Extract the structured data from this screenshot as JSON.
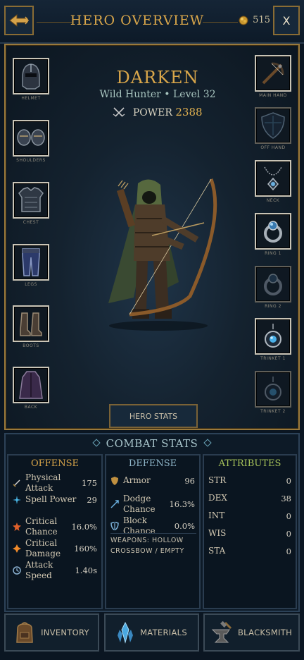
{
  "header": {
    "title": "HERO OVERVIEW",
    "gold": "515",
    "close_label": "X"
  },
  "hero": {
    "name": "DARKEN",
    "subtitle": "Wild Hunter • Level 32",
    "power_label": "POWER",
    "power_value": "2388",
    "stats_button": "HERO STATS"
  },
  "equipment": {
    "left": [
      {
        "label": "HELMET",
        "icon": "helmet-icon"
      },
      {
        "label": "SHOULDERS",
        "icon": "shoulders-icon"
      },
      {
        "label": "CHEST",
        "icon": "chest-armor-icon"
      },
      {
        "label": "LEGS",
        "icon": "leg-armor-icon"
      },
      {
        "label": "BOOTS",
        "icon": "boots-icon"
      },
      {
        "label": "BACK",
        "icon": "cloak-icon"
      }
    ],
    "right": [
      {
        "label": "MAIN HAND",
        "icon": "crossbow-icon"
      },
      {
        "label": "OFF HAND",
        "icon": "shield-icon"
      },
      {
        "label": "NECK",
        "icon": "necklace-icon"
      },
      {
        "label": "RING 1",
        "icon": "ring-icon"
      },
      {
        "label": "RING 2",
        "icon": "ring-icon"
      },
      {
        "label": "TRINKET 1",
        "icon": "trinket-icon"
      },
      {
        "label": "TRINKET 2",
        "icon": "trinket-icon"
      }
    ]
  },
  "combat": {
    "title": "COMBAT STATS",
    "offense": {
      "title": "OFFENSE",
      "rows": [
        {
          "label": "Physical Attack",
          "value": "175",
          "icon": "sword-icon"
        },
        {
          "label": "Spell Power",
          "value": "29",
          "icon": "spark-icon"
        },
        {
          "label": "Critical Chance",
          "value": "16.0%",
          "icon": "crit-chance-icon"
        },
        {
          "label": "Critical Damage",
          "value": "160%",
          "icon": "crit-damage-icon"
        },
        {
          "label": "Attack Speed",
          "value": "1.40s",
          "icon": "attack-speed-icon"
        }
      ]
    },
    "defense": {
      "title": "DEFENSE",
      "rows": [
        {
          "label": "Armor",
          "value": "96",
          "icon": "armor-icon"
        },
        {
          "label": "Dodge Chance",
          "value": "16.3%",
          "icon": "dodge-icon"
        },
        {
          "label": "Block Chance",
          "value": "0.0%",
          "icon": "block-icon"
        }
      ],
      "weapons_line1": "WEAPONS: HOLLOW",
      "weapons_line2": "CROSSBOW / EMPTY"
    },
    "attributes": {
      "title": "ATTRIBUTES",
      "rows": [
        {
          "label": "STR",
          "value": "0"
        },
        {
          "label": "DEX",
          "value": "38"
        },
        {
          "label": "INT",
          "value": "0"
        },
        {
          "label": "WIS",
          "value": "0"
        },
        {
          "label": "STA",
          "value": "0"
        }
      ]
    }
  },
  "nav": {
    "inventory": "INVENTORY",
    "materials": "MATERIALS",
    "blacksmith": "BLACKSMITH"
  },
  "colors": {
    "gold_accent": "#d9a64a",
    "offense_title": "#d9a64a",
    "defense_title": "#8fb6c9",
    "attributes_title": "#a7c35a"
  }
}
